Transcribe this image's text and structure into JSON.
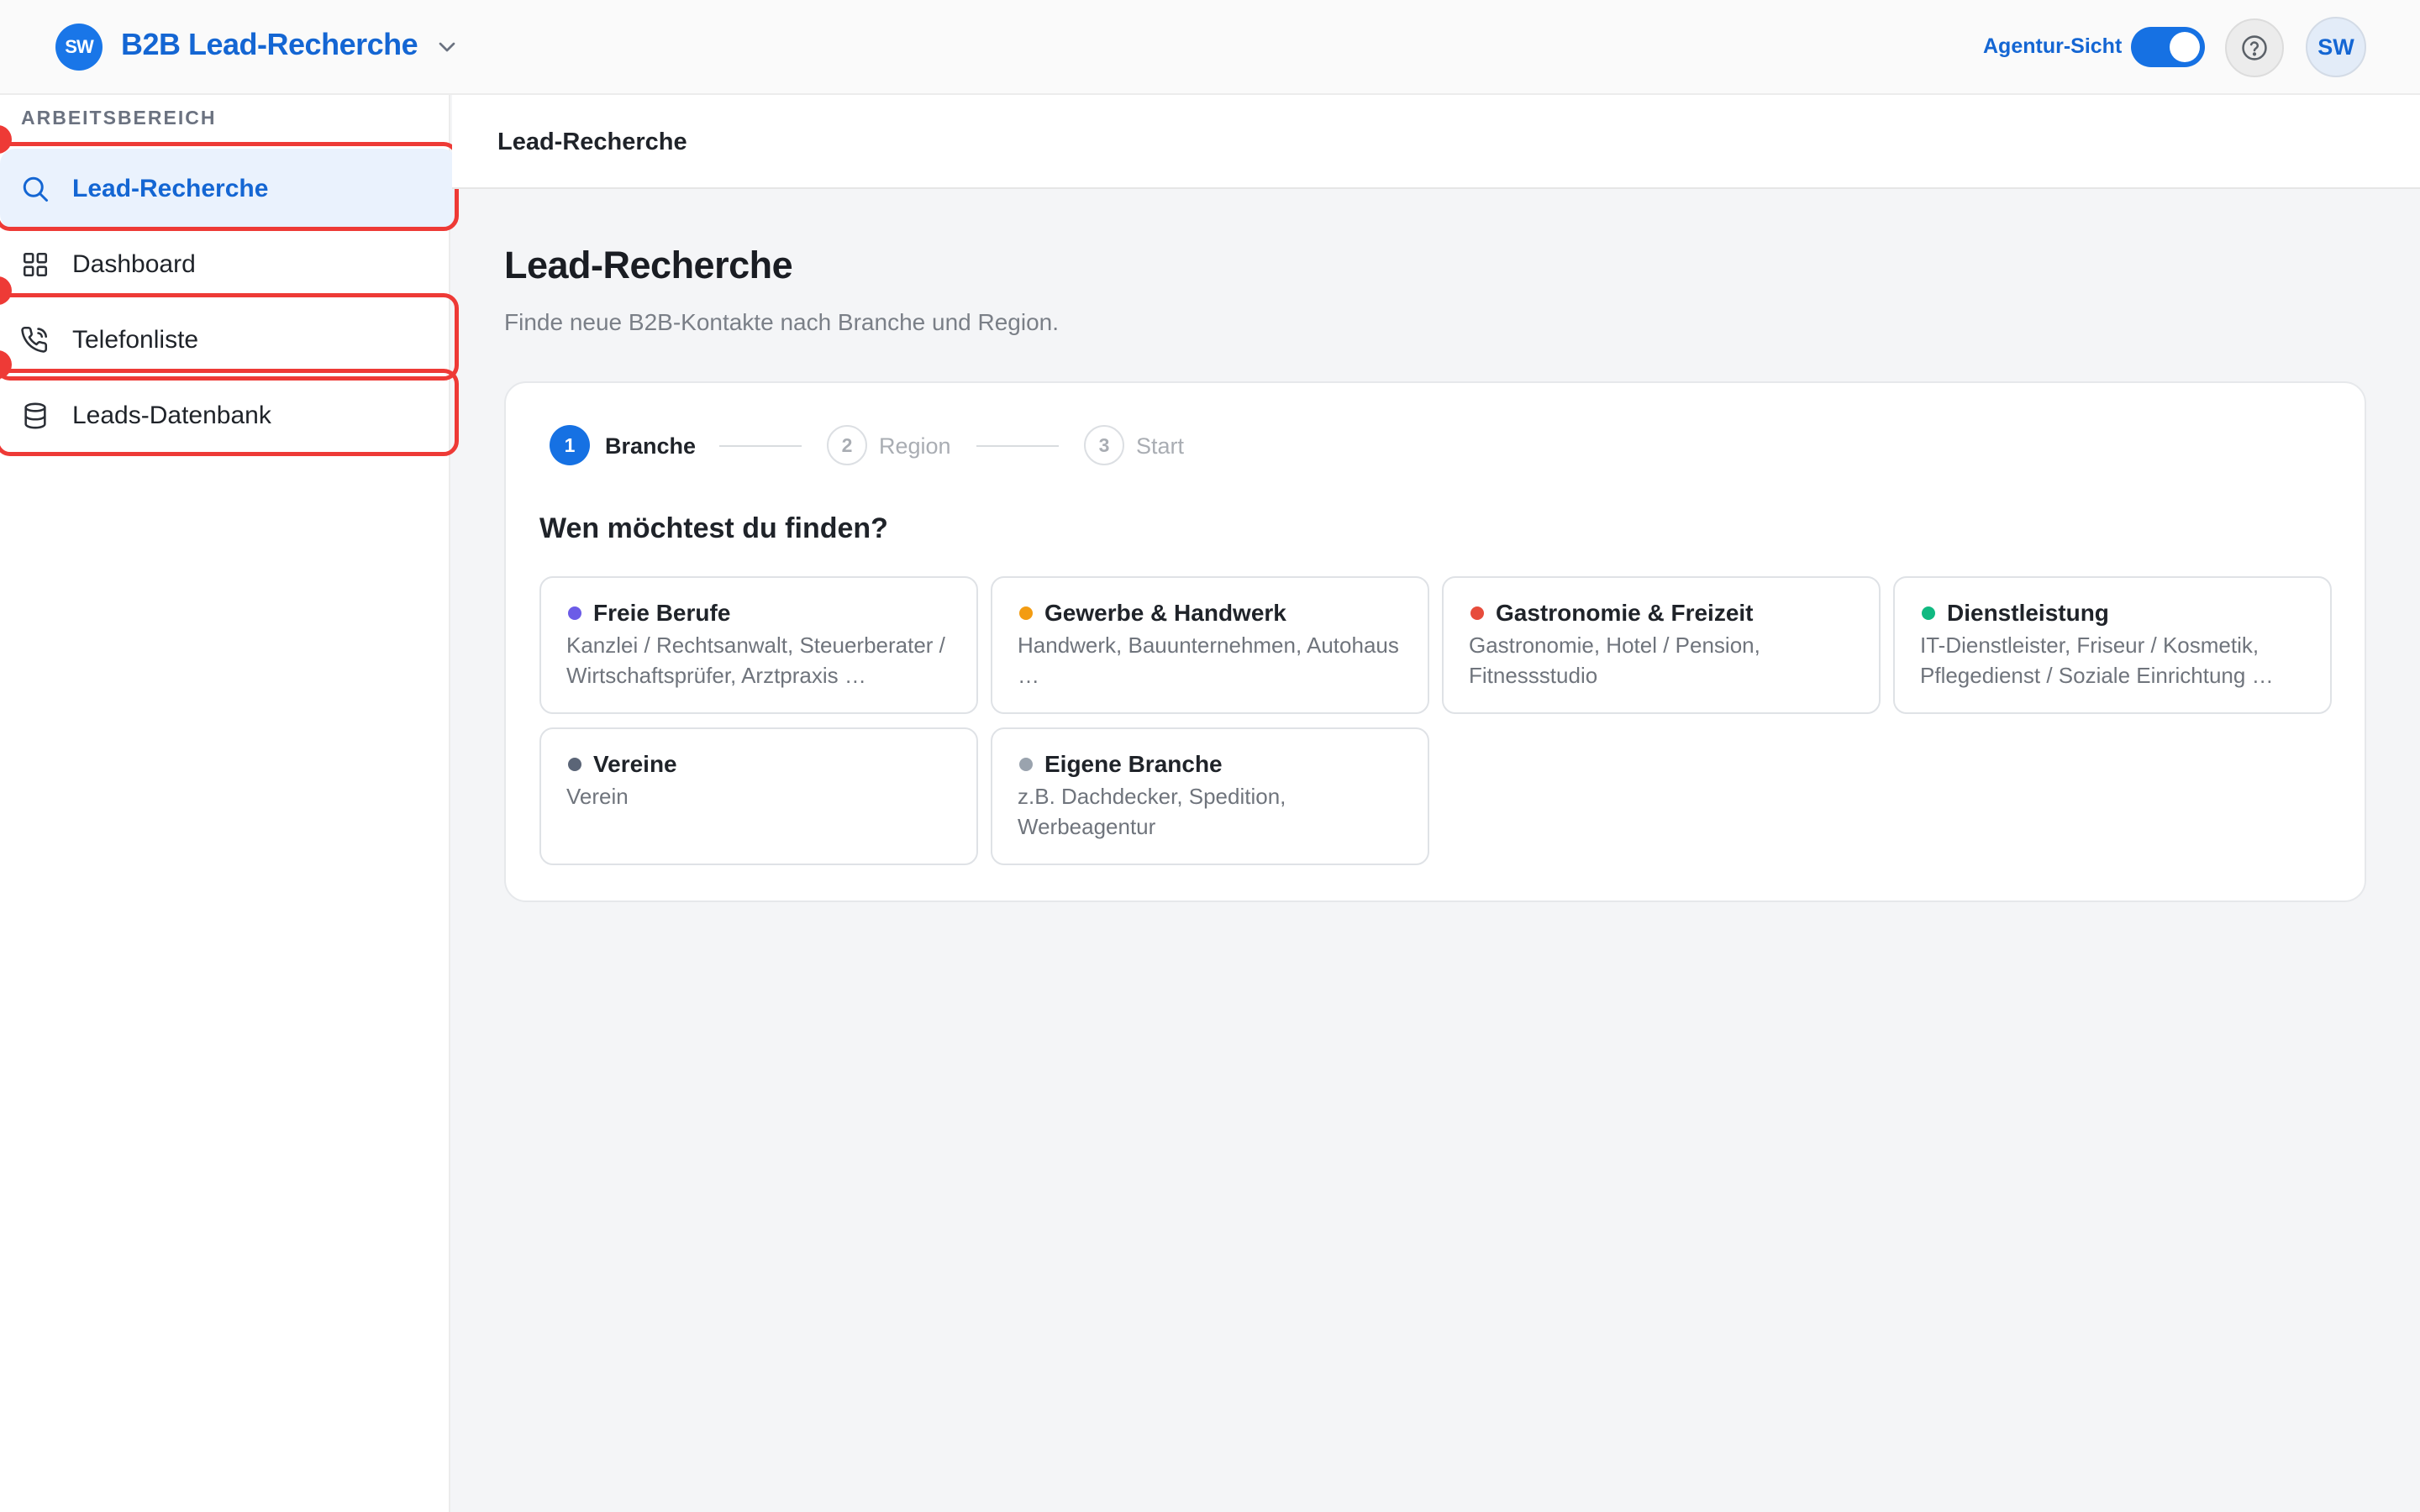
{
  "app": {
    "logo_initials": "SW",
    "title": "B2B Lead-Recherche",
    "agentur_label": "Agentur-Sicht",
    "agentur_on": true,
    "avatar_initials": "SW"
  },
  "sidebar": {
    "section_label": "ARBEITSBEREICH",
    "items": [
      {
        "label": "Lead-Recherche",
        "icon": "search-icon",
        "active": true
      },
      {
        "label": "Dashboard",
        "icon": "grid-icon",
        "active": false
      },
      {
        "label": "Telefonliste",
        "icon": "phone-icon",
        "active": false
      },
      {
        "label": "Leads-Datenbank",
        "icon": "database-icon",
        "active": false
      }
    ]
  },
  "page_header": {
    "title": "Lead-Recherche"
  },
  "main": {
    "title": "Lead-Recherche",
    "subtitle": "Finde neue B2B-Kontakte nach Branche und Region.",
    "steps": [
      {
        "num": "1",
        "label": "Branche",
        "active": true
      },
      {
        "num": "2",
        "label": "Region",
        "active": false
      },
      {
        "num": "3",
        "label": "Start",
        "active": false
      }
    ],
    "question": "Wen möchtest du finden?",
    "industries": [
      {
        "title": "Freie Berufe",
        "desc": "Kanzlei / Rechtsanwalt, Steuerberater / Wirtschaftsprüfer, Arztpraxis …",
        "color": "#6c5ce7"
      },
      {
        "title": "Gewerbe & Handwerk",
        "desc": "Handwerk, Bauunternehmen, Autohaus …",
        "color": "#f39c12"
      },
      {
        "title": "Gastronomie & Freizeit",
        "desc": "Gastronomie, Hotel / Pension, Fitnessstudio",
        "color": "#e74c3c"
      },
      {
        "title": "Dienstleistung",
        "desc": "IT-Dienstleister, Friseur / Kosmetik, Pflegedienst / Soziale Einrichtung …",
        "color": "#10b981"
      },
      {
        "title": "Vereine",
        "desc": "Verein",
        "color": "#5b6577"
      },
      {
        "title": "Eigene Branche",
        "desc": "z.B. Dachdecker, Spedition, Werbeagentur",
        "color": "#9aa3ae"
      }
    ]
  },
  "colors": {
    "accent": "#1671e3",
    "annotation": "#ee3a36"
  }
}
